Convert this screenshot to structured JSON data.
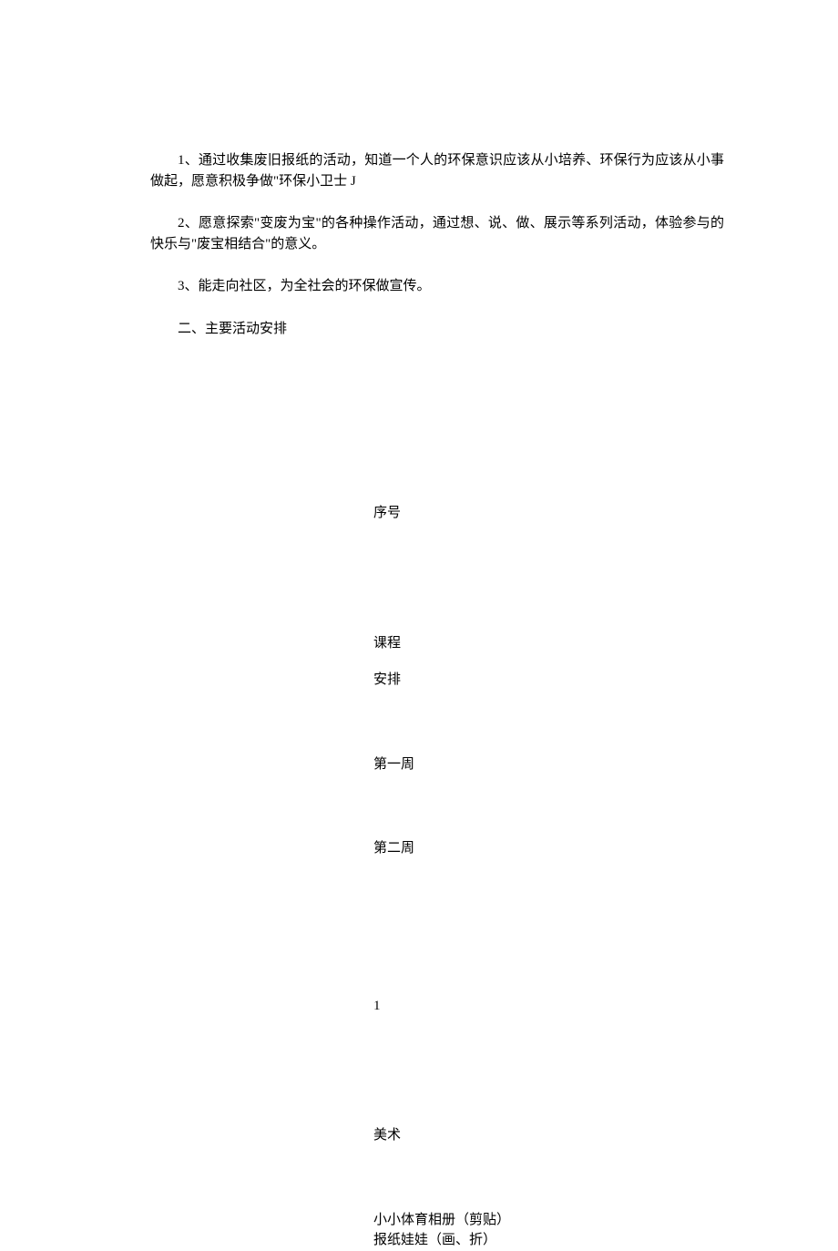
{
  "paragraphs": {
    "p1": "1、通过收集废旧报纸的活动，知道一个人的环保意识应该从小培养、环保行为应该从小事做起，愿意积极争做\"环保小卫士 J",
    "p2": "2、愿意探索\"变废为宝\"的各种操作活动，通过想、说、做、展示等系列活动，体验参与的快乐与\"废宝相结合\"的意义。",
    "p3": "3、能走向社区，为全社会的环保做宣传。",
    "p4": "二、主要活动安排"
  },
  "list": {
    "item1": "序号",
    "item2": "课程",
    "item3": "安排",
    "item4": "第一周",
    "item5": "第二周",
    "item6": "1",
    "item7": "美术",
    "item8": "小小体育相册（剪贴）",
    "item9": "报纸娃娃（画、折）"
  }
}
